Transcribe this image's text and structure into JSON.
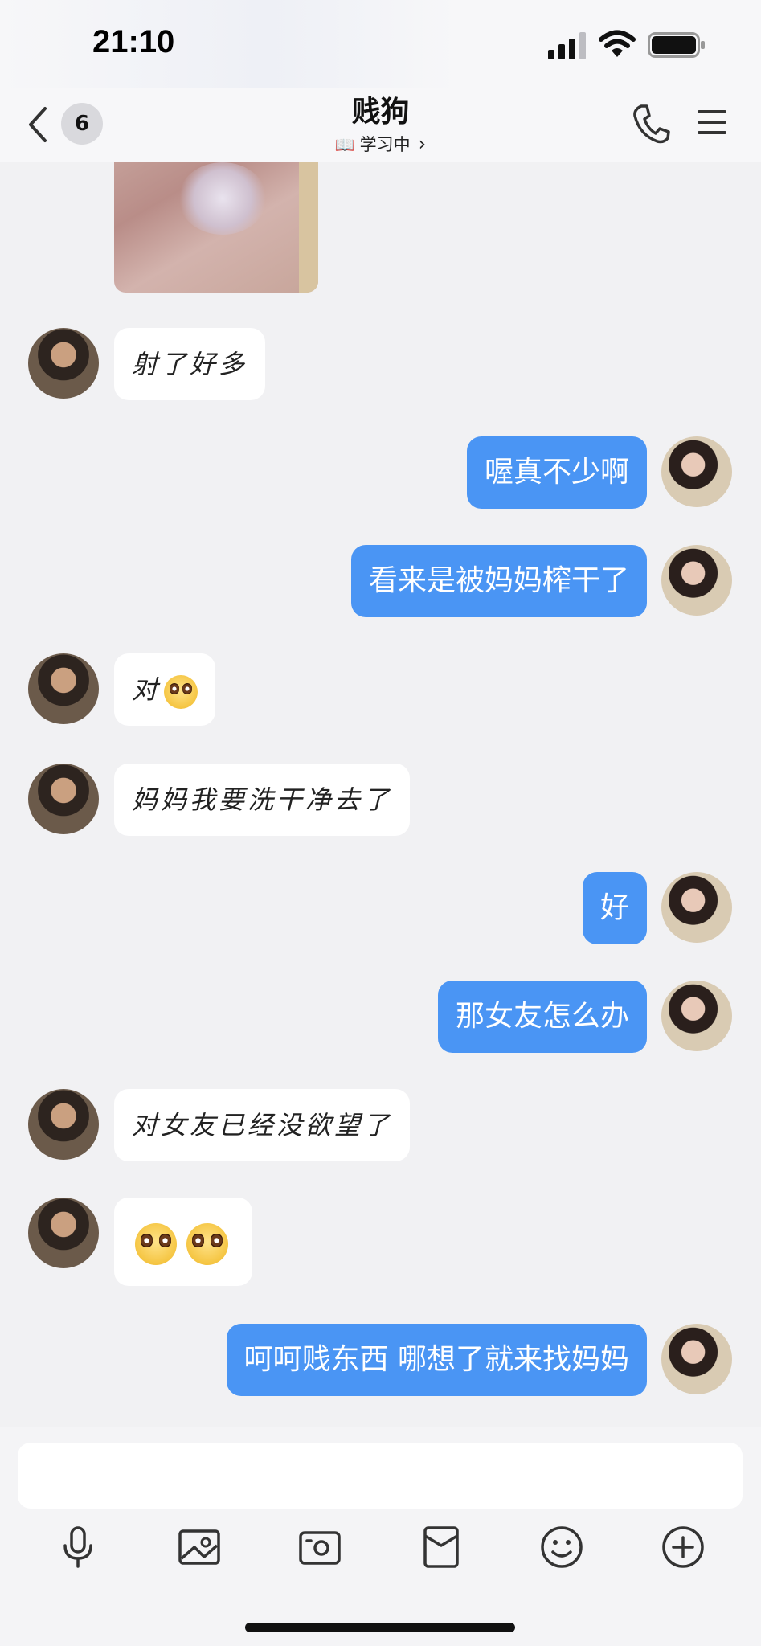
{
  "status_bar": {
    "time": "21:10"
  },
  "header": {
    "unread_count": "6",
    "contact_name": "贱狗",
    "status_icon": "book-icon",
    "status_text": "学习中"
  },
  "messages": [
    {
      "side": "left",
      "text": "射了好多"
    },
    {
      "side": "right",
      "text": "喔真不少啊"
    },
    {
      "side": "right",
      "text": "看来是被妈妈榨干了"
    },
    {
      "side": "left",
      "text": "对",
      "emoji": "pleading-face"
    },
    {
      "side": "left",
      "text": "妈妈我要洗干净去了"
    },
    {
      "side": "right",
      "text": "好"
    },
    {
      "side": "right",
      "text": "那女友怎么办"
    },
    {
      "side": "left",
      "text": "对女友已经没欲望了"
    },
    {
      "side": "left",
      "text": "",
      "emoji": "pleading-face x2"
    },
    {
      "side": "right",
      "text": "呵呵贱东西 哪想了就来找妈妈"
    }
  ],
  "composer": {
    "tools": [
      "microphone-icon",
      "image-icon",
      "camera-icon",
      "red-packet-icon",
      "emoji-icon",
      "plus-icon"
    ]
  },
  "colors": {
    "outgoing_bubble": "#4a95f4",
    "incoming_bubble": "#ffffff",
    "background": "#f1f1f3"
  }
}
